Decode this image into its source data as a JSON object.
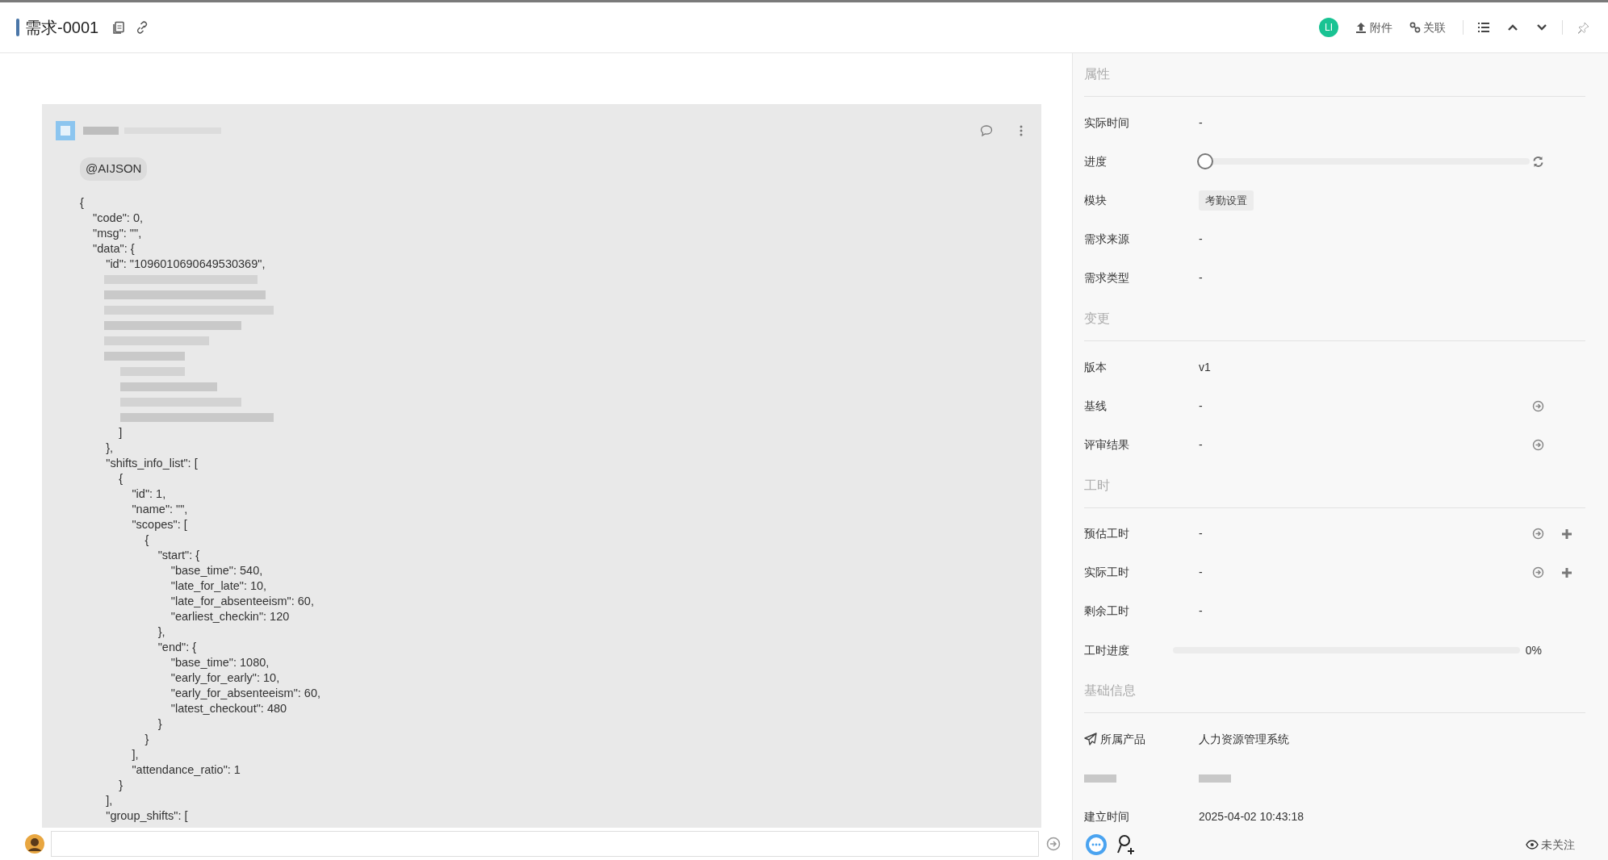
{
  "header": {
    "title": "需求-0001",
    "avatar": {
      "initials": "LI",
      "color": "#19c393"
    },
    "actions": [
      {
        "kind": "upload",
        "label": "附件"
      },
      {
        "kind": "link",
        "label": "关联"
      }
    ]
  },
  "comment": {
    "mention": "@AIJSON",
    "lines": [
      {
        "text": "{"
      },
      {
        "text": "    \"code\": 0,"
      },
      {
        "text": "    \"msg\": \"\","
      },
      {
        "text": "    \"data\": {"
      },
      {
        "text": "        \"id\": \"1096010690649530369\","
      },
      {
        "kind": "blurred"
      },
      {
        "text": "            ]"
      },
      {
        "text": "        },"
      },
      {
        "text": "        \"shifts_info_list\": ["
      },
      {
        "text": "            {"
      },
      {
        "text": "                \"id\": 1,"
      },
      {
        "text": "                \"name\": \"\","
      },
      {
        "text": "                \"scopes\": ["
      },
      {
        "text": "                    {"
      },
      {
        "text": "                        \"start\": {"
      },
      {
        "text": "                            \"base_time\": 540,"
      },
      {
        "text": "                            \"late_for_late\": 10,"
      },
      {
        "text": "                            \"late_for_absenteeism\": 60,"
      },
      {
        "text": "                            \"earliest_checkin\": 120"
      },
      {
        "text": "                        },"
      },
      {
        "text": "                        \"end\": {"
      },
      {
        "text": "                            \"base_time\": 1080,"
      },
      {
        "text": "                            \"early_for_early\": 10,"
      },
      {
        "text": "                            \"early_for_absenteeism\": 60,"
      },
      {
        "text": "                            \"latest_checkout\": 480"
      },
      {
        "text": "                        }"
      },
      {
        "text": "                    }"
      },
      {
        "text": "                ],"
      },
      {
        "text": "                \"attendance_ratio\": 1"
      },
      {
        "text": "            }"
      },
      {
        "text": "        ],"
      },
      {
        "text": "        \"group_shifts\": ["
      }
    ]
  },
  "panel": {
    "sections": [
      {
        "title": "属性",
        "rows": [
          {
            "kind": "text",
            "label": "实际时间",
            "value": "-"
          },
          {
            "kind": "slider",
            "label": "进度",
            "level": 0
          },
          {
            "kind": "tag",
            "label": "模块",
            "value": "考勤设置"
          },
          {
            "kind": "text",
            "label": "需求来源",
            "value": "-"
          },
          {
            "kind": "text",
            "label": "需求类型",
            "value": "-"
          }
        ]
      },
      {
        "title": "变更",
        "rows": [
          {
            "kind": "text",
            "label": "版本",
            "value": "v1"
          },
          {
            "kind": "linked",
            "label": "基线",
            "value": "-"
          },
          {
            "kind": "linked",
            "label": "评审结果",
            "value": "-"
          }
        ]
      },
      {
        "title": "工时",
        "rows": [
          {
            "kind": "hours",
            "label": "预估工时",
            "value": "-"
          },
          {
            "kind": "hours",
            "label": "实际工时",
            "value": "-"
          },
          {
            "kind": "text",
            "label": "剩余工时",
            "value": "-"
          },
          {
            "kind": "progress",
            "label": "工时进度",
            "level": 0,
            "reading": "0%"
          }
        ]
      },
      {
        "title": "基础信息",
        "rows": [
          {
            "kind": "product",
            "label": "所属产品",
            "value": "人力资源管理系统"
          },
          {
            "kind": "blurred"
          },
          {
            "kind": "text",
            "label": "建立时间",
            "value": "2025-04-02 10:43:18"
          }
        ]
      }
    ]
  },
  "footer": {
    "follow": "未关注"
  }
}
